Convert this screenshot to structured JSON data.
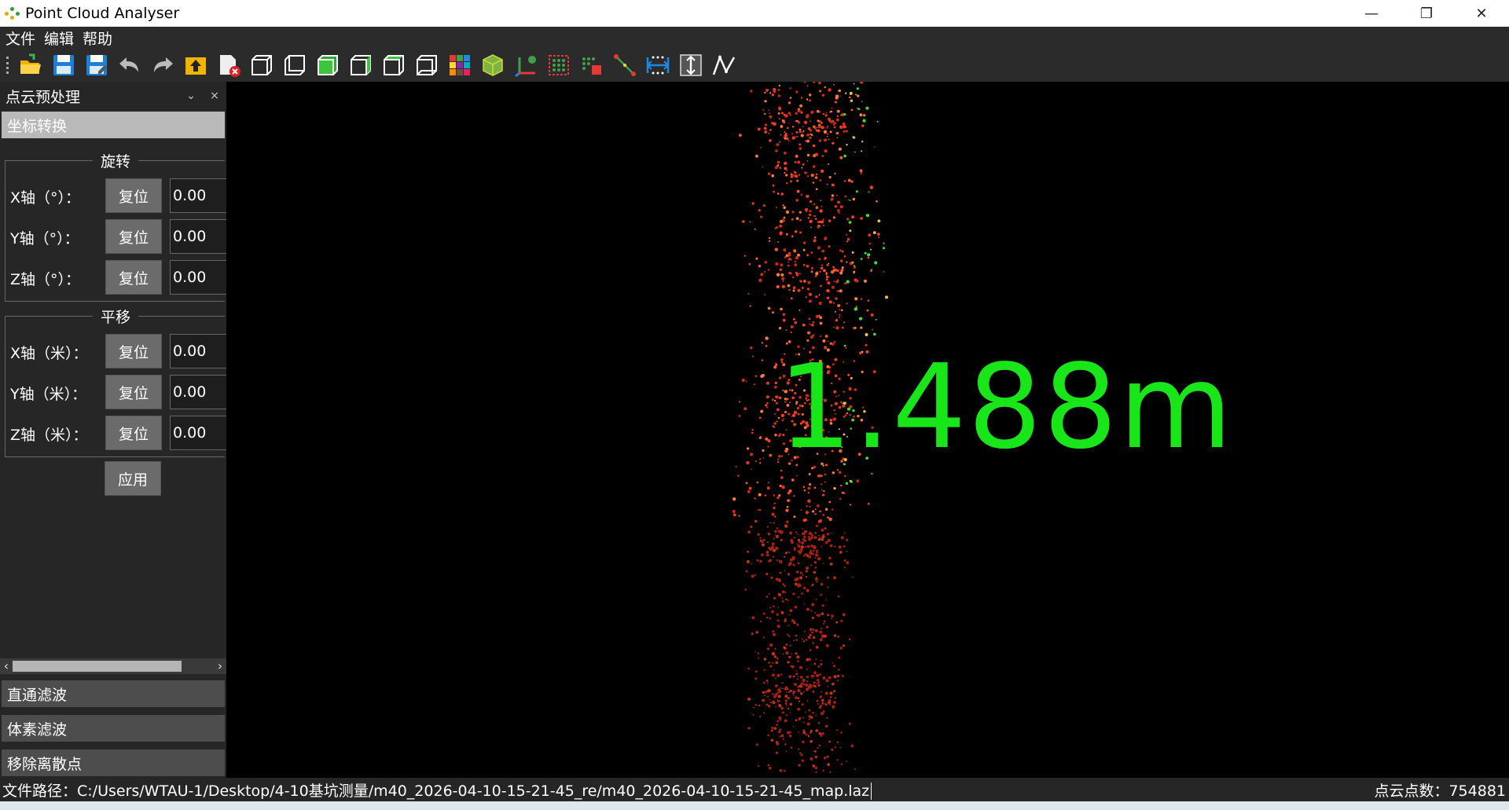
{
  "window": {
    "title": "Point Cloud Analyser",
    "controls": {
      "minimize": "—",
      "restore": "❐",
      "close": "✕"
    }
  },
  "menu": {
    "items": [
      "文件",
      "编辑",
      "帮助"
    ]
  },
  "toolbar": {
    "icons": [
      "open-folder-icon",
      "save-icon",
      "save-as-icon",
      "undo-icon",
      "redo-icon",
      "upload-icon",
      "close-file-icon",
      "view-front-icon",
      "view-back-icon",
      "view-left-icon",
      "view-right-icon",
      "view-top-icon",
      "view-bottom-icon",
      "color-grid-icon",
      "bounding-box-icon",
      "axes-icon",
      "select-points-icon",
      "delete-points-icon",
      "measure-distance-icon",
      "measure-width-icon",
      "measure-height-icon",
      "polyline-icon"
    ]
  },
  "sidebar": {
    "dock_title": "点云预处理",
    "float_btn": "⌄",
    "close_btn": "×",
    "active_section": "坐标转换",
    "rotation": {
      "title": "旋转",
      "rows": [
        {
          "label": "X轴（°）：",
          "reset": "复位",
          "value": "0.00"
        },
        {
          "label": "Y轴（°）：",
          "reset": "复位",
          "value": "0.00"
        },
        {
          "label": "Z轴（°）：",
          "reset": "复位",
          "value": "0.00"
        }
      ]
    },
    "translation": {
      "title": "平移",
      "rows": [
        {
          "label": "X轴（米）：",
          "reset": "复位",
          "value": "0.00"
        },
        {
          "label": "Y轴（米）：",
          "reset": "复位",
          "value": "0.00"
        },
        {
          "label": "Z轴（米）：",
          "reset": "复位",
          "value": "0.00"
        }
      ]
    },
    "apply": "应用",
    "scroll_left": "‹",
    "scroll_right": "›",
    "sections": [
      "直通滤波",
      "体素滤波",
      "移除离散点"
    ]
  },
  "viewport": {
    "measurement": "1.488m",
    "measure_color": "#19e619"
  },
  "status": {
    "path": "文件路径：C:/Users/WTAU-1/Desktop/4-10基坑测量/m40_2026-04-10-15-21-45_re/m40_2026-04-10-15-21-45_map.laz",
    "count": "点云点数：754881"
  }
}
